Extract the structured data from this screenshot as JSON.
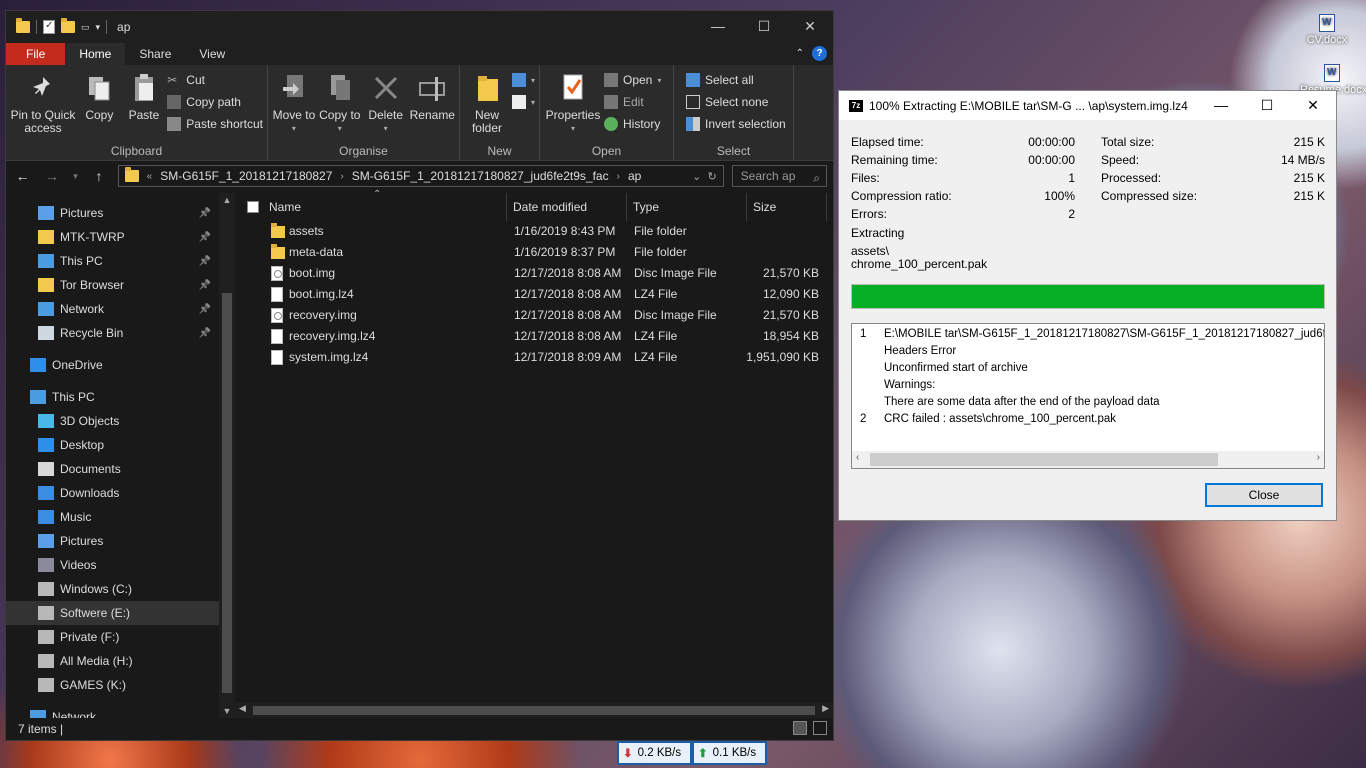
{
  "desktop": {
    "icons": [
      {
        "label": "CV.docx"
      },
      {
        "label": "Resume.docx"
      }
    ]
  },
  "explorer": {
    "title": "ap",
    "window_controls": {
      "minimize": "—",
      "maximize": "☐",
      "close": "✕"
    },
    "ribbon_tabs": [
      "File",
      "Home",
      "Share",
      "View"
    ],
    "ribbon": {
      "clipboard": {
        "pin": "Pin to Quick access",
        "copy": "Copy",
        "paste": "Paste",
        "cut": "Cut",
        "copy_path": "Copy path",
        "paste_shortcut": "Paste shortcut",
        "label": "Clipboard"
      },
      "organise": {
        "move_to": "Move to",
        "copy_to": "Copy to",
        "delete": "Delete",
        "rename": "Rename",
        "label": "Organise"
      },
      "new": {
        "new_folder": "New folder",
        "label": "New"
      },
      "open": {
        "properties": "Properties",
        "open": "Open",
        "edit": "Edit",
        "history": "History",
        "label": "Open"
      },
      "select": {
        "select_all": "Select all",
        "select_none": "Select none",
        "invert": "Invert selection",
        "label": "Select"
      }
    },
    "address": {
      "prefix": "«",
      "crumbs": [
        "SM-G615F_1_20181217180827",
        "SM-G615F_1_20181217180827_jud6fe2t9s_fac",
        "ap"
      ]
    },
    "search_placeholder": "Search ap",
    "nav": [
      {
        "label": "Pictures",
        "icon": "pictures-icon",
        "pinned": true
      },
      {
        "label": "MTK-TWRP",
        "icon": "folder-icon",
        "pinned": true
      },
      {
        "label": "This PC",
        "icon": "this-pc-icon",
        "pinned": true
      },
      {
        "label": "Tor Browser",
        "icon": "folder-icon",
        "pinned": true
      },
      {
        "label": "Network",
        "icon": "network-icon",
        "pinned": true
      },
      {
        "label": "Recycle Bin",
        "icon": "recycle-bin-icon",
        "pinned": true
      },
      {
        "label": "OneDrive",
        "icon": "onedrive-icon",
        "pinned": false
      },
      {
        "label": "This PC",
        "icon": "this-pc-icon",
        "pinned": false
      },
      {
        "label": "3D Objects",
        "icon": "3d-objects-icon",
        "pinned": false
      },
      {
        "label": "Desktop",
        "icon": "desktop-icon",
        "pinned": false
      },
      {
        "label": "Documents",
        "icon": "documents-icon",
        "pinned": false
      },
      {
        "label": "Downloads",
        "icon": "downloads-icon",
        "pinned": false
      },
      {
        "label": "Music",
        "icon": "music-icon",
        "pinned": false
      },
      {
        "label": "Pictures",
        "icon": "pictures-icon",
        "pinned": false
      },
      {
        "label": "Videos",
        "icon": "videos-icon",
        "pinned": false
      },
      {
        "label": "Windows (C:)",
        "icon": "drive-icon",
        "pinned": false
      },
      {
        "label": "Softwere (E:)",
        "icon": "drive-icon",
        "pinned": false,
        "selected": true
      },
      {
        "label": "Private (F:)",
        "icon": "drive-icon",
        "pinned": false
      },
      {
        "label": "All Media (H:)",
        "icon": "drive-icon",
        "pinned": false
      },
      {
        "label": "GAMES (K:)",
        "icon": "drive-icon",
        "pinned": false
      },
      {
        "label": "Network",
        "icon": "network-icon",
        "pinned": false
      }
    ],
    "columns": [
      "Name",
      "Date modified",
      "Type",
      "Size"
    ],
    "files": [
      {
        "name": "assets",
        "date": "1/16/2019 8:43 PM",
        "type": "File folder",
        "size": "",
        "icon": "folder"
      },
      {
        "name": "meta-data",
        "date": "1/16/2019 8:37 PM",
        "type": "File folder",
        "size": "",
        "icon": "folder"
      },
      {
        "name": "boot.img",
        "date": "12/17/2018 8:08 AM",
        "type": "Disc Image File",
        "size": "21,570 KB",
        "icon": "disc"
      },
      {
        "name": "boot.img.lz4",
        "date": "12/17/2018 8:08 AM",
        "type": "LZ4 File",
        "size": "12,090 KB",
        "icon": "file"
      },
      {
        "name": "recovery.img",
        "date": "12/17/2018 8:08 AM",
        "type": "Disc Image File",
        "size": "21,570 KB",
        "icon": "disc"
      },
      {
        "name": "recovery.img.lz4",
        "date": "12/17/2018 8:08 AM",
        "type": "LZ4 File",
        "size": "18,954 KB",
        "icon": "file"
      },
      {
        "name": "system.img.lz4",
        "date": "12/17/2018 8:09 AM",
        "type": "LZ4 File",
        "size": "1,951,090 KB",
        "icon": "file"
      }
    ],
    "status": "7 items  |"
  },
  "zip": {
    "title": "100% Extracting E:\\MOBILE tar\\SM-G ... \\ap\\system.img.lz4",
    "logo": "7z",
    "left_stats": [
      {
        "label": "Elapsed time:",
        "value": "00:00:00"
      },
      {
        "label": "Remaining time:",
        "value": "00:00:00"
      },
      {
        "label": "Files:",
        "value": "1"
      },
      {
        "label": "Compression ratio:",
        "value": "100%"
      },
      {
        "label": "Errors:",
        "value": "2"
      }
    ],
    "right_stats": [
      {
        "label": "Total size:",
        "value": "215 K"
      },
      {
        "label": "Speed:",
        "value": "14 MB/s"
      },
      {
        "label": "Processed:",
        "value": "215 K"
      },
      {
        "label": "Compressed size:",
        "value": "215 K"
      }
    ],
    "action": "Extracting",
    "current_dir": "assets\\",
    "current_file": "chrome_100_percent.pak",
    "progress_percent": 100,
    "progress_color": "#06b025",
    "log": [
      {
        "num": "1",
        "text": "E:\\MOBILE tar\\SM-G615F_1_20181217180827\\SM-G615F_1_20181217180827_jud6fe2t9s"
      },
      {
        "num": "",
        "text": "Headers Error"
      },
      {
        "num": "",
        "text": "Unconfirmed start of archive"
      },
      {
        "num": "",
        "text": "Warnings:"
      },
      {
        "num": "",
        "text": "There are some data after the end of the payload data"
      },
      {
        "num": "2",
        "text": "CRC failed : assets\\chrome_100_percent.pak"
      }
    ],
    "close_label": "Close"
  },
  "net": {
    "down": "0.2 KB/s",
    "up": "0.1 KB/s"
  }
}
